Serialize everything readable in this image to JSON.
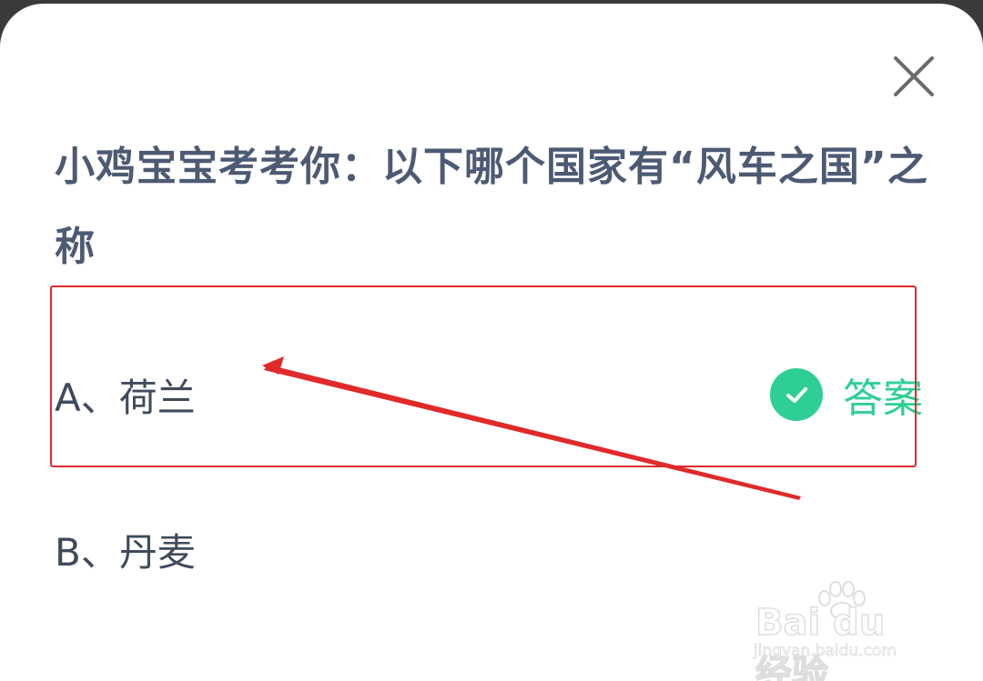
{
  "dialog": {
    "close_icon": "close-icon",
    "question": "小鸡宝宝考考你：以下哪个国家有“风车之国”之称"
  },
  "options": [
    {
      "label": "A、荷兰",
      "is_answer": true
    },
    {
      "label": "B、丹麦",
      "is_answer": false
    }
  ],
  "answer_badge": {
    "icon": "check-circle-icon",
    "label": "答案",
    "color": "#2ecf95"
  },
  "annotation": {
    "color": "#e02a2a",
    "shapes": [
      "highlight-rectangle",
      "arrow"
    ]
  },
  "watermark": {
    "logo": "Bai du 经验",
    "url": "jingyan.baidu.com"
  }
}
